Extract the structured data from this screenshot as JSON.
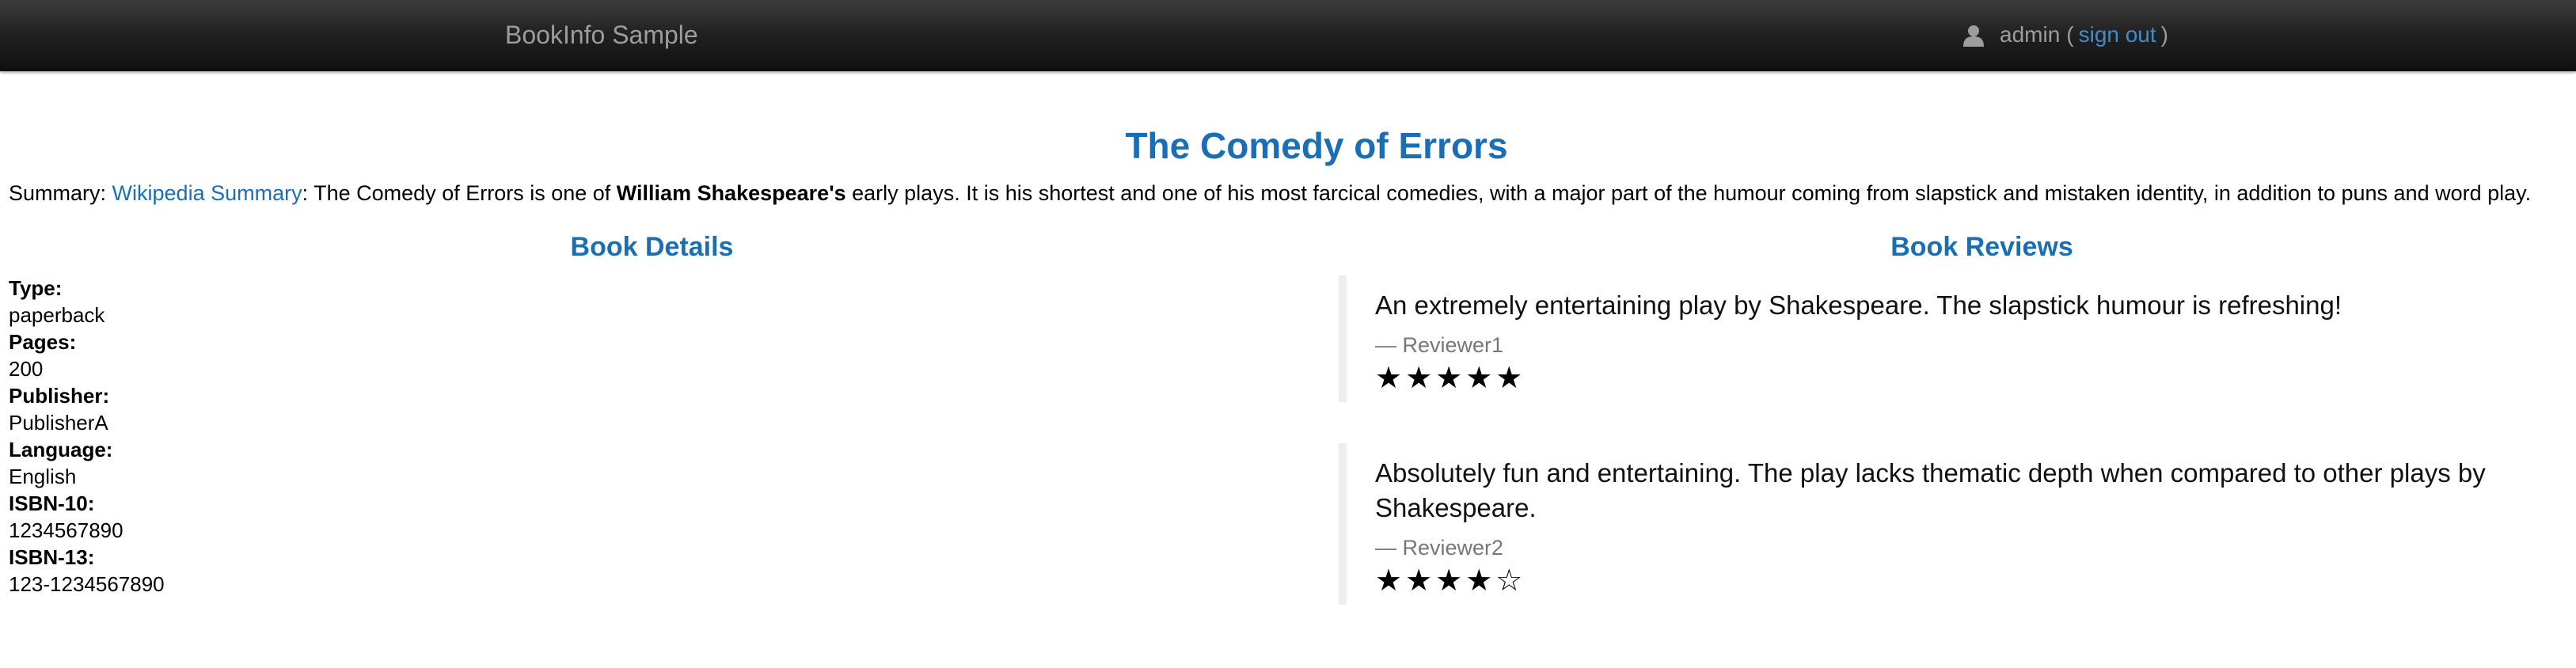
{
  "navbar": {
    "brand": "BookInfo Sample",
    "user_icon": "user-icon",
    "user_name": "admin",
    "paren_open": "(",
    "sign_out": "sign out",
    "paren_close": ")"
  },
  "book": {
    "title": "The Comedy of Errors",
    "summary_prefix": "Summary:",
    "summary_link": "Wikipedia Summary",
    "summary_text_1": ": The Comedy of Errors is one of",
    "summary_bold": "William Shakespeare's",
    "summary_text_2": "early plays. It is his shortest and one of his most farcical comedies, with a major part of the humour coming from slapstick and mistaken identity, in addition to puns and word play."
  },
  "details": {
    "heading": "Book Details",
    "fields": [
      {
        "label": "Type:",
        "value": "paperback"
      },
      {
        "label": "Pages:",
        "value": "200"
      },
      {
        "label": "Publisher:",
        "value": "PublisherA"
      },
      {
        "label": "Language:",
        "value": "English"
      },
      {
        "label": "ISBN-10:",
        "value": "1234567890"
      },
      {
        "label": "ISBN-13:",
        "value": "123-1234567890"
      }
    ]
  },
  "reviews": {
    "heading": "Book Reviews",
    "items": [
      {
        "text": "An extremely entertaining play by Shakespeare. The slapstick humour is refreshing!",
        "author": "— Reviewer1",
        "rating": 5,
        "max_rating": 5,
        "stars": "★★★★★"
      },
      {
        "text": "Absolutely fun and entertaining. The play lacks thematic depth when compared to other plays by Shakespeare.",
        "author": "— Reviewer2",
        "rating": 4,
        "max_rating": 5,
        "stars": "★★★★☆"
      }
    ]
  },
  "colors": {
    "navbar_bg": "#222222",
    "brand_text": "#9d9d9d",
    "link": "#428bca",
    "heading": "#1a6eb4",
    "review_border": "#eeeeee"
  }
}
